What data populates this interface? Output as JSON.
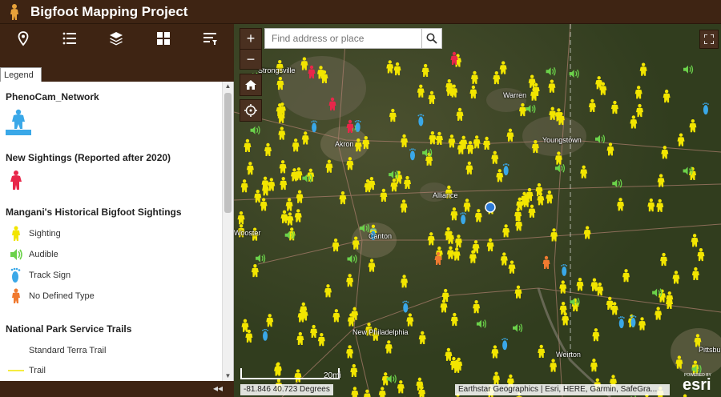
{
  "header": {
    "title": "Bigfoot Mapping Project",
    "logo_icon": "bigfoot-logo-icon"
  },
  "toolbar": {
    "items": [
      {
        "name": "location-icon"
      },
      {
        "name": "list-icon"
      },
      {
        "name": "layers-icon"
      },
      {
        "name": "grid-icon"
      },
      {
        "name": "filter-list-icon"
      }
    ]
  },
  "legend": {
    "tab_label": "Legend",
    "layers": [
      {
        "title": "PhenoCam_Network",
        "items": []
      },
      {
        "title": "New Sightings (Reported after 2020)",
        "items": []
      },
      {
        "title": "Mangani's Historical Bigfoot Sightings",
        "items": [
          {
            "label": "Sighting",
            "color": "#f2e500"
          },
          {
            "label": "Audible",
            "color": "#6bd24a"
          },
          {
            "label": "Track Sign",
            "color": "#3aa8e8"
          },
          {
            "label": "No Defined Type",
            "color": "#f07a30"
          }
        ]
      },
      {
        "title": "National Park Service Trails",
        "items": [
          {
            "label": "Standard Terra Trail"
          },
          {
            "label": "Trail",
            "color": "#f2e500"
          }
        ]
      }
    ],
    "phenocam_color": "#3aa8e8",
    "new_sighting_color": "#e8274a"
  },
  "map": {
    "search_placeholder": "Find address or place",
    "zoom_in": "+",
    "zoom_out": "−",
    "scale_label": "20mi",
    "coordinates": "-81.846 40.723 Degrees",
    "attribution": "Earthstar Geographics | Esri, HERE, Garmin, SafeGra...",
    "powered_by": "POWERED BY",
    "esri": "esri",
    "cities": [
      "Strongsville",
      "Warren",
      "Akron",
      "Youngstown",
      "Alliance",
      "Wooster",
      "Canton",
      "New Philadelphia",
      "Weirton",
      "Pittsbu"
    ],
    "colors": {
      "sighting": "#f2e500",
      "audible": "#6bd24a",
      "track": "#3aa8e8",
      "undefined": "#f07a30",
      "new": "#e8274a",
      "location_dot": "#2d7ad6"
    }
  }
}
